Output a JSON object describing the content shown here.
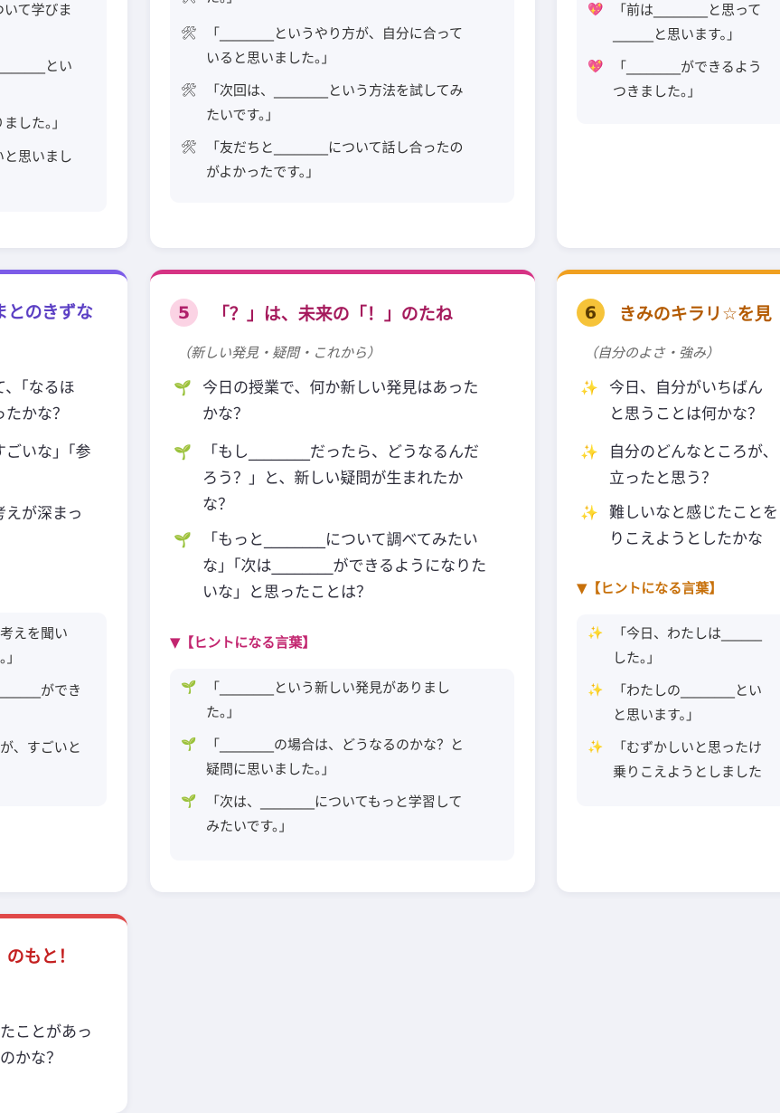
{
  "card_top_left": {
    "lines": [
      "ついて学びま",
      "________とい",
      "りました。」",
      "いと思いまし"
    ]
  },
  "card_top_mid": {
    "items": [
      {
        "icon": "🛠",
        "lines": [
          "た。」"
        ]
      },
      {
        "icon": "🛠",
        "lines": [
          "「________というやり方が、自分に合って",
          "いると思いました。」"
        ]
      },
      {
        "icon": "🛠",
        "lines": [
          "「次回は、________という方法を試してみ",
          "たいです。」"
        ]
      },
      {
        "icon": "🛠",
        "lines": [
          "「友だちと________について話し合ったの",
          "がよかったです。」"
        ]
      }
    ]
  },
  "card_top_right": {
    "items": [
      {
        "icon": "💖",
        "lines": [
          "「前は________と思って",
          "______と思います。」"
        ]
      },
      {
        "icon": "💖",
        "lines": [
          "「________ができるよう",
          "つきました。」"
        ]
      }
    ]
  },
  "card4": {
    "title": "まとのきずな",
    "accent": "#7c5ce8",
    "question_lines": [
      "て、「なるほ",
      "ったかな？",
      "すごいな」「参",
      "考えが深まっ"
    ],
    "hint_lines": [
      "考えを聞い",
      "。」",
      "______ができ",
      "が、すごいと"
    ]
  },
  "card5": {
    "number": "5",
    "title": "「？」は、未来の「！」のたね",
    "subtitle": "（新しい発見・疑問・これから）",
    "accent": "#d63384",
    "questions": [
      {
        "icon": "🌱",
        "lines": [
          "今日の授業で、何か新しい発見はあった",
          "かな？"
        ]
      },
      {
        "icon": "🌱",
        "lines": [
          "「もし________だったら、どうなるんだ",
          "ろう？」と、新しい疑問が生まれたか",
          "な？"
        ]
      },
      {
        "icon": "🌱",
        "lines": [
          "「もっと________について調べてみたい",
          "な」「次は________ができるようになりた",
          "いな」と思ったことは？"
        ]
      }
    ],
    "hint_label": "▼【ヒントになる言葉】",
    "hints": [
      {
        "icon": "🌱",
        "lines": [
          "「________という新しい発見がありまし",
          "た。」"
        ]
      },
      {
        "icon": "🌱",
        "lines": [
          "「________の場合は、どうなるのかな？と",
          "疑問に思いました。」"
        ]
      },
      {
        "icon": "🌱",
        "lines": [
          "「次は、________についてもっと学習して",
          "みたいです。」"
        ]
      }
    ]
  },
  "card6": {
    "number": "6",
    "title": "きみのキラリ☆を見",
    "subtitle": "（自分のよさ・強み）",
    "accent": "#f0a020",
    "questions": [
      {
        "icon": "✨",
        "lines": [
          "今日、自分がいちばん",
          "と思うことは何かな？"
        ]
      },
      {
        "icon": "✨",
        "lines": [
          "自分のどんなところが、",
          "立ったと思う？"
        ]
      },
      {
        "icon": "✨",
        "lines": [
          "難しいなと感じたことを",
          "りこえようとしたかな"
        ]
      }
    ],
    "hint_label": "▼【ヒントになる言葉】",
    "hints": [
      {
        "icon": "✨",
        "lines": [
          "「今日、わたしは______",
          "した。」"
        ]
      },
      {
        "icon": "✨",
        "lines": [
          "「わたしの________とい",
          "と思います。」"
        ]
      },
      {
        "icon": "✨",
        "lines": [
          "「むずかしいと思ったけ",
          "乗りこえようとしました"
        ]
      }
    ]
  },
  "card7": {
    "title": "のもと！",
    "accent": "#e04848",
    "lines": [
      "たことがあっ",
      "のかな？"
    ]
  }
}
